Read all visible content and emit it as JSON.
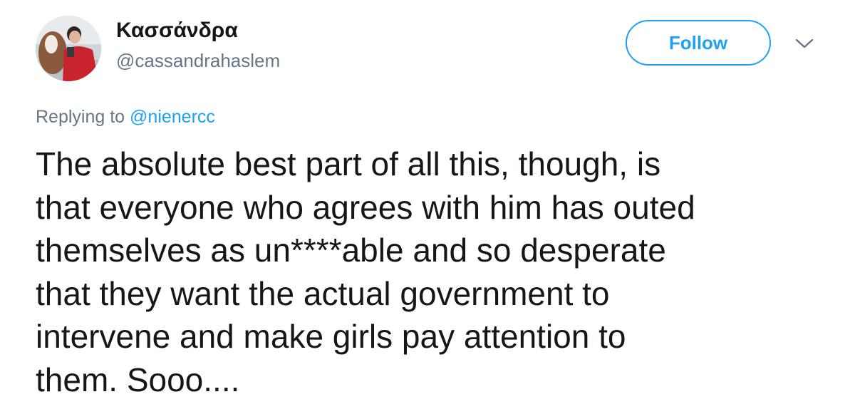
{
  "author": {
    "display_name": "Κασσάνδρα",
    "handle": "@cassandrahaslem",
    "avatar_icon": "profile-photo-avatar"
  },
  "actions": {
    "follow_label": "Follow",
    "menu_icon": "chevron-down-icon"
  },
  "reply": {
    "prefix": "Replying to ",
    "mention": "@nienercc"
  },
  "tweet": {
    "text": "The absolute best part of all this, though, is\nthat everyone who agrees with him has outed\nthemselves as un****able and so desperate\nthat they want the actual government to\nintervene and make girls pay attention to\nthem. Sooo...."
  },
  "colors": {
    "accent": "#1da1f2",
    "text": "#14171a",
    "secondary_text": "#657786"
  }
}
